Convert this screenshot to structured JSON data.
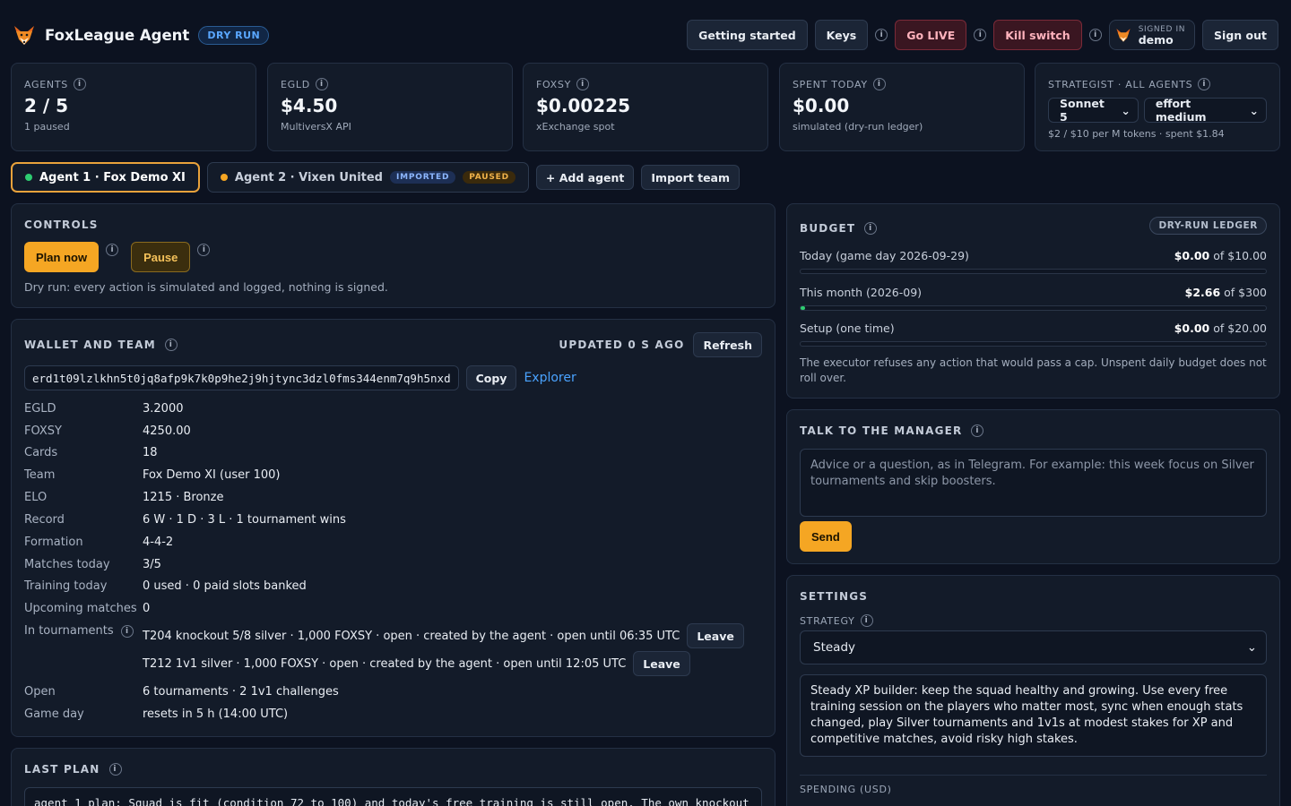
{
  "app": {
    "title": "FoxLeague Agent",
    "mode_badge": "DRY RUN"
  },
  "header": {
    "getting_started": "Getting started",
    "keys": "Keys",
    "go_live": "Go LIVE",
    "kill_switch": "Kill switch",
    "signed_in_label": "SIGNED IN",
    "username": "demo",
    "sign_out": "Sign out"
  },
  "stats": {
    "agents": {
      "label": "AGENTS",
      "value": "2 / 5",
      "sub": "1 paused"
    },
    "egld": {
      "label": "EGLD",
      "value": "$4.50",
      "sub": "MultiversX API"
    },
    "foxsy": {
      "label": "FOXSY",
      "value": "$0.00225",
      "sub": "xExchange spot"
    },
    "spent": {
      "label": "SPENT TODAY",
      "value": "$0.00",
      "sub": "simulated (dry-run ledger)"
    },
    "strategist": {
      "label": "STRATEGIST · ALL AGENTS",
      "model": "Sonnet 5",
      "effort": "effort medium",
      "sub": "$2 / $10 per M tokens · spent $1.84"
    }
  },
  "agents": [
    {
      "label": "Agent 1 · Fox Demo XI",
      "status_color": "#2ecc71"
    },
    {
      "label": "Agent 2 · Vixen United",
      "status_color": "#f5a623",
      "badge_imported": "IMPORTED",
      "badge_paused": "PAUSED"
    }
  ],
  "agent_actions": {
    "add": "+ Add agent",
    "import": "Import team"
  },
  "controls": {
    "title": "CONTROLS",
    "plan_now": "Plan now",
    "pause": "Pause",
    "note": "Dry run: every action is simulated and logged, nothing is signed."
  },
  "wallet": {
    "title": "WALLET AND TEAM",
    "updated": "UPDATED 0 S AGO",
    "refresh": "Refresh",
    "address": "erd1t09lzlkhn5t0jq8afp9k7k0p9he2j9hjtync3dzl0fms344enm7q9h5nxd",
    "copy": "Copy",
    "explorer": "Explorer",
    "rows": {
      "egld": {
        "k": "EGLD",
        "v": "3.2000"
      },
      "foxsy": {
        "k": "FOXSY",
        "v": "4250.00"
      },
      "cards": {
        "k": "Cards",
        "v": "18"
      },
      "team": {
        "k": "Team",
        "v": "Fox Demo XI (user 100)"
      },
      "elo": {
        "k": "ELO",
        "v": "1215 · Bronze"
      },
      "record": {
        "k": "Record",
        "v": "6 W · 1 D · 3 L · 1 tournament wins"
      },
      "formation": {
        "k": "Formation",
        "v": "4-4-2"
      },
      "matches": {
        "k": "Matches today",
        "v": "3/5"
      },
      "training": {
        "k": "Training today",
        "v": "0 used · 0 paid slots banked"
      },
      "upcoming": {
        "k": "Upcoming matches",
        "v": "0"
      },
      "tournaments": {
        "k": "In tournaments"
      },
      "open": {
        "k": "Open",
        "v": "6 tournaments · 2 1v1 challenges"
      },
      "gameday": {
        "k": "Game day",
        "v": "resets in 5 h (14:00 UTC)"
      }
    },
    "tournaments": [
      {
        "text": "T204 knockout 5/8 silver · 1,000 FOXSY · open · created by the agent · open until 06:35 UTC",
        "action": "Leave"
      },
      {
        "text": "T212 1v1 silver · 1,000 FOXSY · open · created by the agent · open until 12:05 UTC",
        "action": "Leave"
      }
    ]
  },
  "last_plan": {
    "title": "LAST PLAN",
    "text": "agent 1 plan: Squad is fit (condition 72 to 100) and today's free training is still open. The own knockout"
  },
  "budget": {
    "title": "BUDGET",
    "badge": "DRY-RUN LEDGER",
    "today": {
      "label": "Today (game day 2026-09-29)",
      "used": "$0.00",
      "of": "of $10.00",
      "fraction": 0
    },
    "month": {
      "label": "This month (2026-09)",
      "used": "$2.66",
      "of": "of $300",
      "fraction": 0.0089
    },
    "setup": {
      "label": "Setup (one time)",
      "used": "$0.00",
      "of": "of $20.00",
      "fraction": 0
    },
    "note": "The executor refuses any action that would pass a cap. Unspent daily budget does not roll over."
  },
  "manager": {
    "title": "TALK TO THE MANAGER",
    "placeholder": "Advice or a question, as in Telegram. For example: this week focus on Silver tournaments and skip boosters.",
    "send": "Send"
  },
  "settings": {
    "title": "SETTINGS",
    "strategy_label": "STRATEGY",
    "strategy_value": "Steady",
    "strategy_desc": "Steady XP builder: keep the squad healthy and growing. Use every free training session on the players who matter most, sync when enough stats changed, play Silver tournaments and 1v1s at modest stakes for XP and competitive matches, avoid risky high stakes.",
    "spending_label": "SPENDING (USD)"
  }
}
